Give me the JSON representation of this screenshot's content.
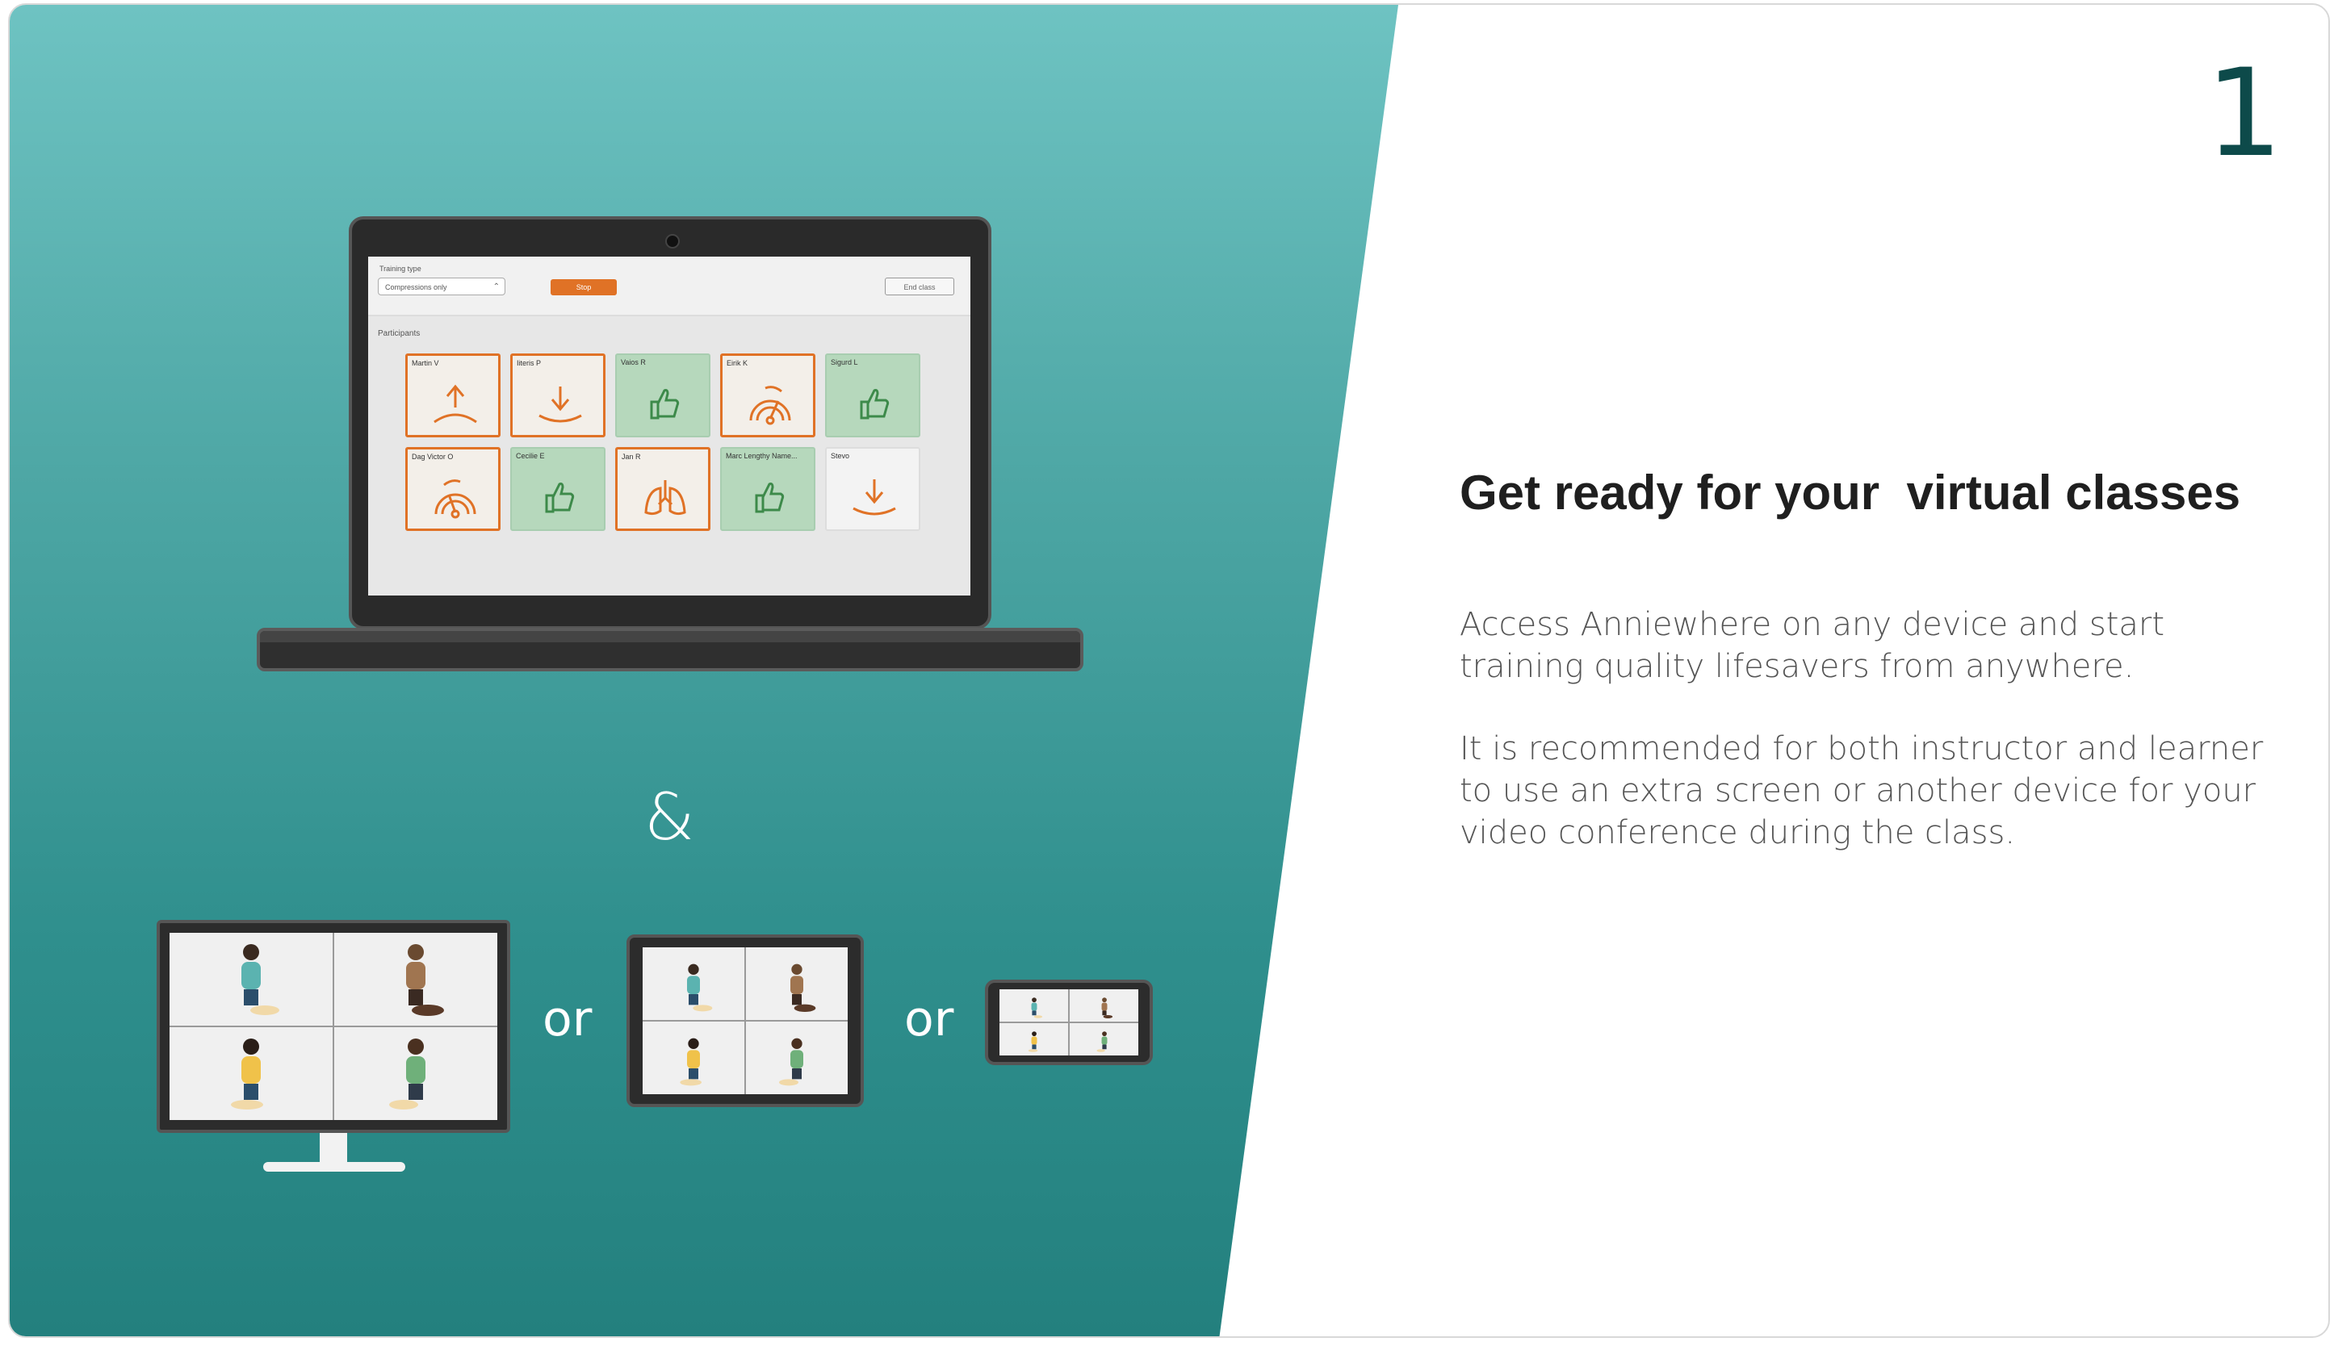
{
  "step_number": "1",
  "heading": "Get ready for your  virtual classes",
  "paragraphs": [
    "Access Anniewhere on any device and start training quality lifesavers from anywhere.",
    "It is recommended for both instructor and learner to use an extra screen or another device for your video conference during the class."
  ],
  "laptop_app": {
    "training_type_label": "Training type",
    "training_type_value": "Compressions only",
    "stop_label": "Stop",
    "end_class_label": "End class",
    "participants_label": "Participants",
    "participants": [
      {
        "name": "Martin V",
        "status": "orange",
        "icon": "arrow-up-icon"
      },
      {
        "name": "Iiteris P",
        "status": "orange",
        "icon": "arrow-down-icon"
      },
      {
        "name": "Vaios R",
        "status": "green",
        "icon": "thumbs-up-icon"
      },
      {
        "name": "Eirik K",
        "status": "orange",
        "icon": "gauge-icon"
      },
      {
        "name": "Sigurd L",
        "status": "green",
        "icon": "thumbs-up-icon"
      },
      {
        "name": "Dag Victor O",
        "status": "orange",
        "icon": "gauge-icon"
      },
      {
        "name": "Cecilie E",
        "status": "green",
        "icon": "thumbs-up-icon"
      },
      {
        "name": "Jan R",
        "status": "orange",
        "icon": "lungs-icon"
      },
      {
        "name": "Marc Lengthy Name...",
        "status": "green",
        "icon": "thumbs-up-icon"
      },
      {
        "name": "Stevo",
        "status": "grey",
        "icon": "arrow-down-icon"
      }
    ]
  },
  "ampersand": "&",
  "or_labels": [
    "or",
    "or"
  ],
  "colors": {
    "teal_top": "#6ec3c2",
    "teal_bottom": "#23807e",
    "step_number": "#0d4a4a",
    "warning_orange": "#e07226",
    "ok_green": "#b6d8bc"
  }
}
